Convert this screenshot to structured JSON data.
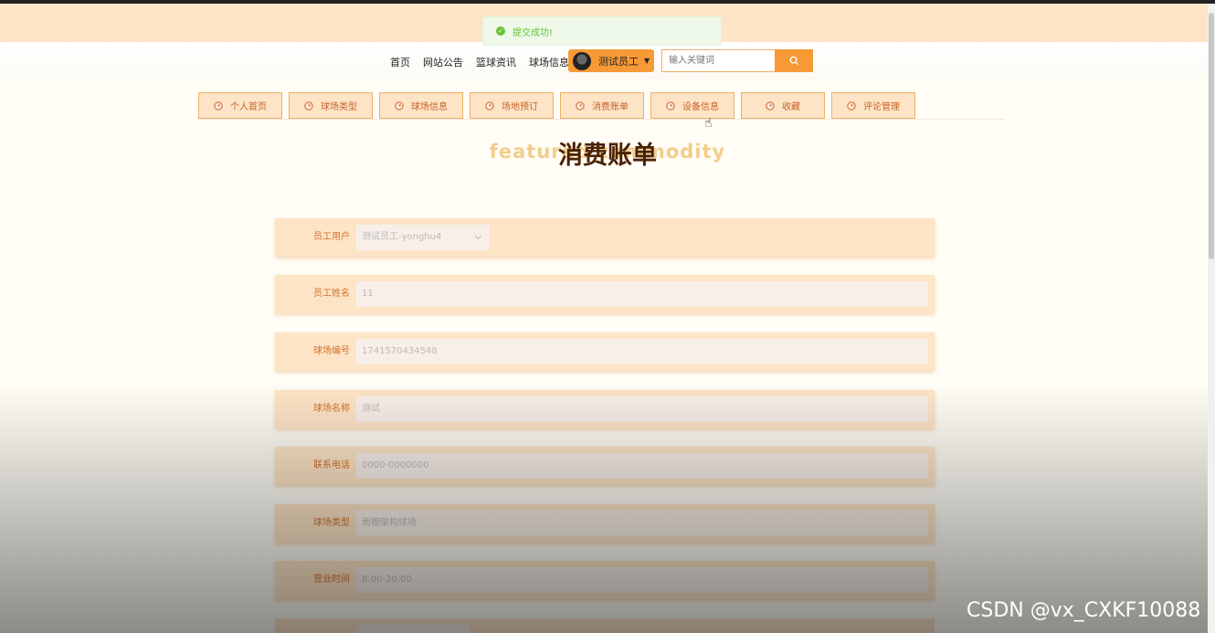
{
  "toast": {
    "message": "提交成功!"
  },
  "nav": {
    "links": [
      "首页",
      "网站公告",
      "篮球资讯",
      "球场信息"
    ]
  },
  "user": {
    "name": "测试员工"
  },
  "search": {
    "placeholder": "输入关键词"
  },
  "tabs": [
    "个人首页",
    "球场类型",
    "球场信息",
    "场地预订",
    "消费账单",
    "设备信息",
    "收藏",
    "评论管理"
  ],
  "page": {
    "title": "消费账单",
    "title_bg": "featured commodity"
  },
  "form": {
    "rows": [
      {
        "label": "员工用户",
        "value": "测试员工-yonghu4"
      },
      {
        "label": "员工姓名",
        "value": "11"
      },
      {
        "label": "球场编号",
        "value": "1741570434548"
      },
      {
        "label": "球场名称",
        "value": "测试"
      },
      {
        "label": "联系电话",
        "value": "0000-0000000"
      },
      {
        "label": "球场类型",
        "value": "雨棚架构球场"
      },
      {
        "label": "营业时间",
        "value": "8:00-20:00"
      }
    ]
  },
  "watermark": "CSDN @vx_CXKF10088",
  "colors": {
    "accent": "#f79a36",
    "band": "#fde4c6",
    "tab_text": "#c8622b",
    "title": "#4a2200",
    "success": "#67c23a"
  }
}
